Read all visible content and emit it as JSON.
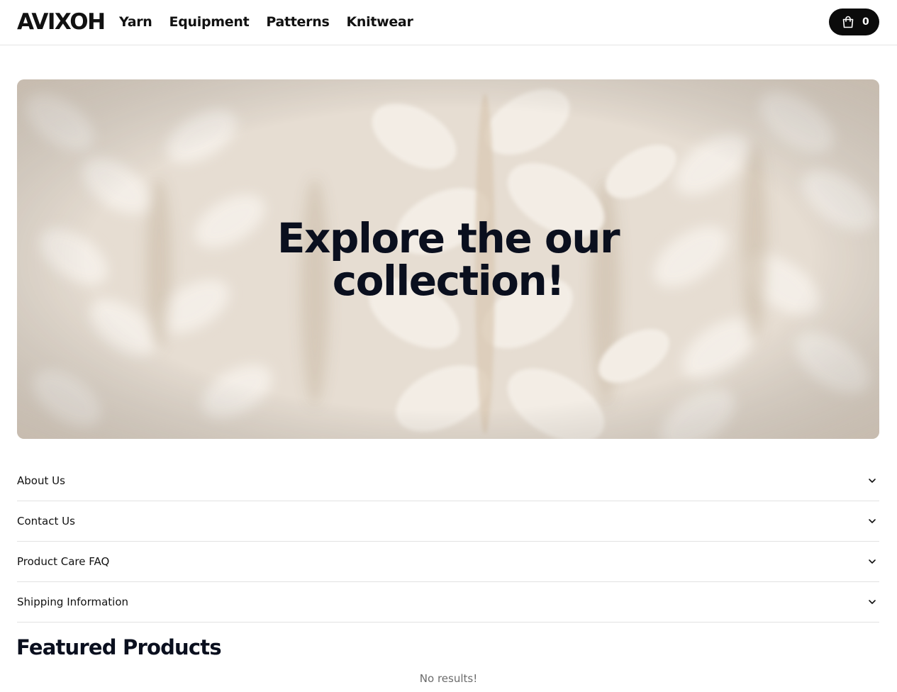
{
  "header": {
    "logo": "AVIXOH",
    "nav": [
      "Yarn",
      "Equipment",
      "Patterns",
      "Knitwear"
    ],
    "cart_count": "0",
    "cart_icon": "shopping-bag-icon"
  },
  "hero": {
    "title_line1": "Explore the our",
    "title_line2": "collection!"
  },
  "accordion": [
    "About Us",
    "Contact Us",
    "Product Care FAQ",
    "Shipping Information"
  ],
  "featured": {
    "title": "Featured Products",
    "empty_message": "No results!"
  },
  "colors": {
    "text": "#0a0f1e",
    "cart_bg": "#0b0b0b",
    "divider": "#e2e2e2"
  }
}
